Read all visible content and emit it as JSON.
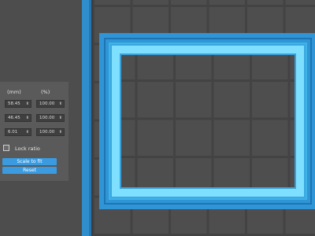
{
  "scale_panel": {
    "header_mm": "(mm)",
    "header_percent": "(%)",
    "rows": [
      {
        "mm": "58.45",
        "percent": "100.00"
      },
      {
        "mm": "46.45",
        "percent": "100.00"
      },
      {
        "mm": "6.01",
        "percent": "100.00"
      }
    ],
    "spinner_glyph": "⬍",
    "lock_ratio_label": "Lock ratio",
    "lock_ratio_checked": false,
    "scale_to_fit_label": "Scale to fit",
    "reset_label": "Reset"
  },
  "colors": {
    "accent": "#3a9be0",
    "selection_outer": "#2f95d6",
    "selection_inner": "#7fdfff",
    "grid_background": "#4e4e4e",
    "grid_lines": "#434343"
  }
}
